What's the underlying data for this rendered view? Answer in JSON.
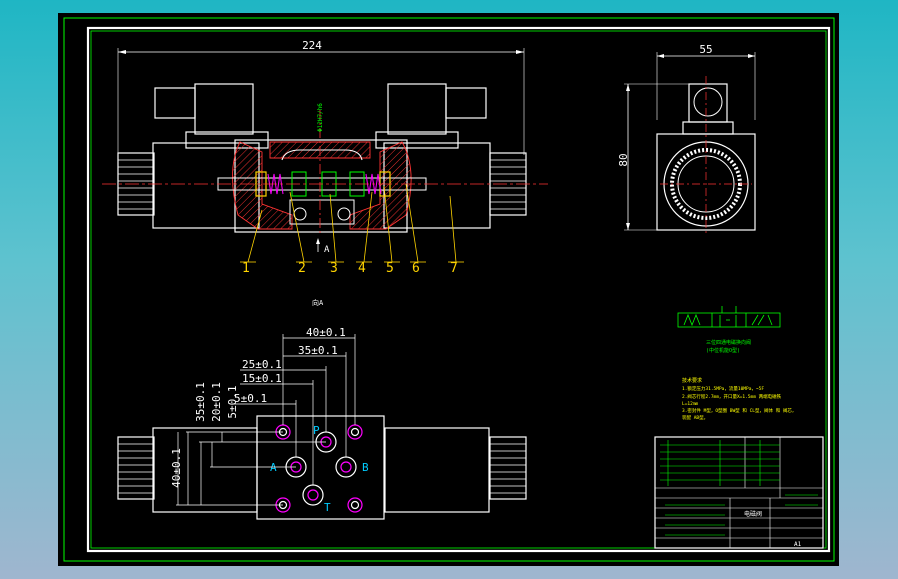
{
  "drawing": {
    "colors": {
      "background": "#000000",
      "sheet_border": "#00ff00",
      "inner_frame": "#ffffff",
      "dimension": "#ffffff",
      "outline": "#ffffff",
      "centerline": "#ff3333",
      "leader": "#ffd400",
      "hatch": "#ff3333",
      "highlight": "#ff00ff",
      "annotation": "#00ff00",
      "notes": "#ffff00"
    },
    "top_dims": {
      "overall_width": "224",
      "side_width": "55",
      "side_height": "80"
    },
    "part_callouts": [
      "1",
      "2",
      "3",
      "4",
      "5",
      "6",
      "7"
    ],
    "section_marker": "A",
    "view_label": "向A",
    "bottom_dims": {
      "d40": "40±0.1",
      "d35": "35±0.1",
      "d25": "25±0.1",
      "d15": "15±0.1",
      "d5": "5±0.1",
      "v35": "35±0.1",
      "v20": "20±0.1",
      "v5": "5±0.1",
      "v40": "40±0.1"
    },
    "port_labels": {
      "p": "P",
      "a": "A",
      "b": "B",
      "t": "T"
    },
    "symbol_caption": [
      "三位四通电磁换向阀",
      "(中位机能O型)"
    ],
    "tech_notes": {
      "title": "技术要求",
      "lines": [
        "1.额定压力31.5MPa，流量10MPa，~5F",
        "2.阀芯行程2.7mm，开口量X=1.5mm 两端电磁铁",
        "L=12mm",
        "3.密封件 M型，O型圈 BW型 和 CL型，阀体 和 阀芯，",
        "装配 AB型。"
      ]
    },
    "title_block": {
      "drawing_title": "电磁阀",
      "sheet_size": "A1"
    }
  }
}
